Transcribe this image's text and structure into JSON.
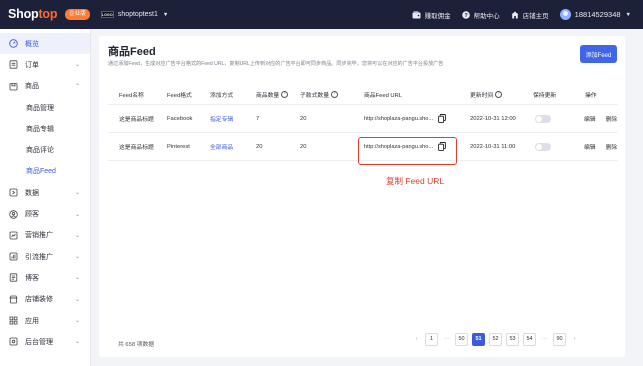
{
  "topbar": {
    "logo_part1": "Shop",
    "logo_part2": "top",
    "plan_badge": "企业版",
    "store_logo_text": "LOGO",
    "store_name": "shoptoptest1",
    "items": [
      {
        "label": "赚取佣金",
        "icon": "wallet-icon"
      },
      {
        "label": "帮助中心",
        "icon": "help-circle-icon"
      },
      {
        "label": "店铺主页",
        "icon": "home-icon"
      }
    ],
    "user_phone": "18814529348"
  },
  "sidebar": {
    "items": [
      {
        "label": "概览",
        "icon": "dashboard-icon"
      },
      {
        "label": "订单",
        "icon": "order-icon"
      },
      {
        "label": "商品",
        "icon": "product-icon"
      },
      {
        "label": "商品管理"
      },
      {
        "label": "商品专辑"
      },
      {
        "label": "商品评论"
      },
      {
        "label": "商品Feed"
      },
      {
        "label": "数据",
        "icon": "data-icon"
      },
      {
        "label": "顾客",
        "icon": "customer-icon"
      },
      {
        "label": "营销推广",
        "icon": "marketing-icon"
      },
      {
        "label": "引流推广",
        "icon": "traffic-icon"
      },
      {
        "label": "博客",
        "icon": "blog-icon"
      },
      {
        "label": "店铺装修",
        "icon": "theme-icon"
      },
      {
        "label": "应用",
        "icon": "apps-icon"
      },
      {
        "label": "后台管理",
        "icon": "settings-icon"
      }
    ]
  },
  "main": {
    "title": "商品Feed",
    "description": "通过添加Feed，生成对应广告平台格式的Feed URL，复制URL上传到对应的广告平台即可同步商品。同步完毕，您将可以在对应的广告平台投放广告",
    "add_button": "添加Feed",
    "table": {
      "headers": [
        "Feed名称",
        "Feed格式",
        "添加方式",
        "商品数量",
        "子款式数量",
        "商品Feed URL",
        "更新时间",
        "保持更新",
        "操作"
      ],
      "rows": [
        {
          "name": "这是商品标题",
          "format": "Facebook",
          "method": "指定专辑",
          "products": "7",
          "variants": "20",
          "url": "http://shoplaza-pangu.sho...",
          "updated": "2022-10-31 12:00",
          "keep_updated": false,
          "edit": "编辑",
          "delete": "删除"
        },
        {
          "name": "这是商品标题",
          "format": "Pinterest",
          "method": "全部商品",
          "products": "20",
          "variants": "20",
          "url": "http://shoplaza-pangu.sho...",
          "updated": "2022-10-31 11:00",
          "keep_updated": false,
          "edit": "编辑",
          "delete": "删除"
        }
      ]
    },
    "annotation": "复制 Feed URL",
    "total_text": "共 658 项数据",
    "pagination": {
      "pages": [
        "1",
        "···",
        "50",
        "51",
        "52",
        "53",
        "54",
        "···",
        "90"
      ],
      "current": "51"
    }
  },
  "colors": {
    "topbar_bg": "#1c2038",
    "accent": "#3b5bdb",
    "button": "#4066e8",
    "brand_orange": "#ff6a2c",
    "highlight_red": "#e23c2c"
  }
}
